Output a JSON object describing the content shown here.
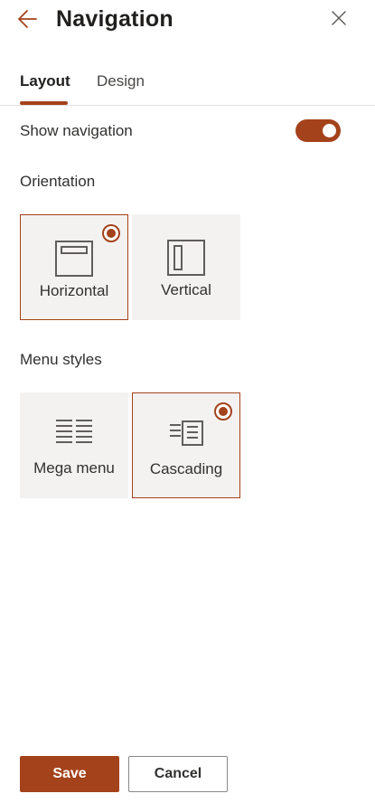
{
  "header": {
    "title": "Navigation",
    "back_icon": "arrow-left-icon",
    "close_icon": "close-icon"
  },
  "tabs": [
    {
      "label": "Layout",
      "active": true
    },
    {
      "label": "Design",
      "active": false
    }
  ],
  "show_navigation": {
    "label": "Show navigation",
    "enabled": true
  },
  "orientation": {
    "label": "Orientation",
    "options": [
      {
        "label": "Horizontal",
        "icon": "horizontal-layout-icon",
        "selected": true
      },
      {
        "label": "Vertical",
        "icon": "vertical-layout-icon",
        "selected": false
      }
    ]
  },
  "menu_styles": {
    "label": "Menu styles",
    "options": [
      {
        "label": "Mega menu",
        "icon": "mega-menu-icon",
        "selected": false
      },
      {
        "label": "Cascading",
        "icon": "cascading-menu-icon",
        "selected": true
      }
    ]
  },
  "footer": {
    "save_label": "Save",
    "cancel_label": "Cancel"
  },
  "colors": {
    "accent": "#a4421b",
    "card_bg": "#f3f2f1",
    "text": "#323130"
  }
}
